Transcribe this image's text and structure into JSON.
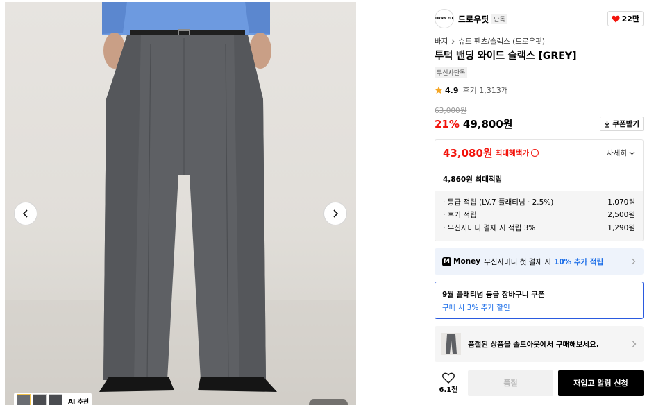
{
  "gallery": {
    "prev_icon": "chevron-left-icon",
    "next_icon": "chevron-right-icon",
    "ai_recommend_label": "AI 추천",
    "counter": ""
  },
  "brand": {
    "logo_text": "DRAW FIT",
    "name": "드로우핏",
    "badge": "단독",
    "likes": "22만"
  },
  "breadcrumb": {
    "category": "바지",
    "subcategory": "슈트 팬츠/슬랙스 (드로우핏)"
  },
  "product": {
    "title": "투턱 밴딩 와이드 슬랙스 [GREY]",
    "exclusive_tag": "무신사단독",
    "rating": "4.9",
    "reviews": "후기 1,313개",
    "original_price": "63,000원",
    "discount": "21%",
    "sale_price": "49,800원",
    "coupon_label": "쿠폰받기"
  },
  "benefits": {
    "max_price": "43,080원",
    "max_label": "최대혜택가",
    "detail_label": "자세히",
    "points_total": "4,860원 최대적립",
    "points": [
      {
        "label": "· 등급 적립 (LV.7 플래티넘 · 2.5%)",
        "value": "1,070원"
      },
      {
        "label": "· 후기 적립",
        "value": "2,500원"
      },
      {
        "label": "· 무신사머니 결제 시 적립 3%",
        "value": "1,290원"
      }
    ]
  },
  "money_banner": {
    "brand": "Money",
    "text": "무신사머니 첫 결제 시",
    "highlight": "10% 추가 적립"
  },
  "coupon_banner": {
    "title": "9월 플래티넘 등급 장바구니 쿠폰",
    "subtitle": "구매 시 3% 추가 할인"
  },
  "soldout_banner": {
    "text": "품절된 상품을 솔드아웃에서 구매해보세요."
  },
  "actions": {
    "wish_count": "6.1천",
    "soldout_label": "품절",
    "restock_label": "재입고 알림 신청"
  },
  "colors": {
    "accent_red": "#f2140c",
    "accent_blue": "#1c6ee8",
    "coupon_border": "#2a5adf"
  }
}
